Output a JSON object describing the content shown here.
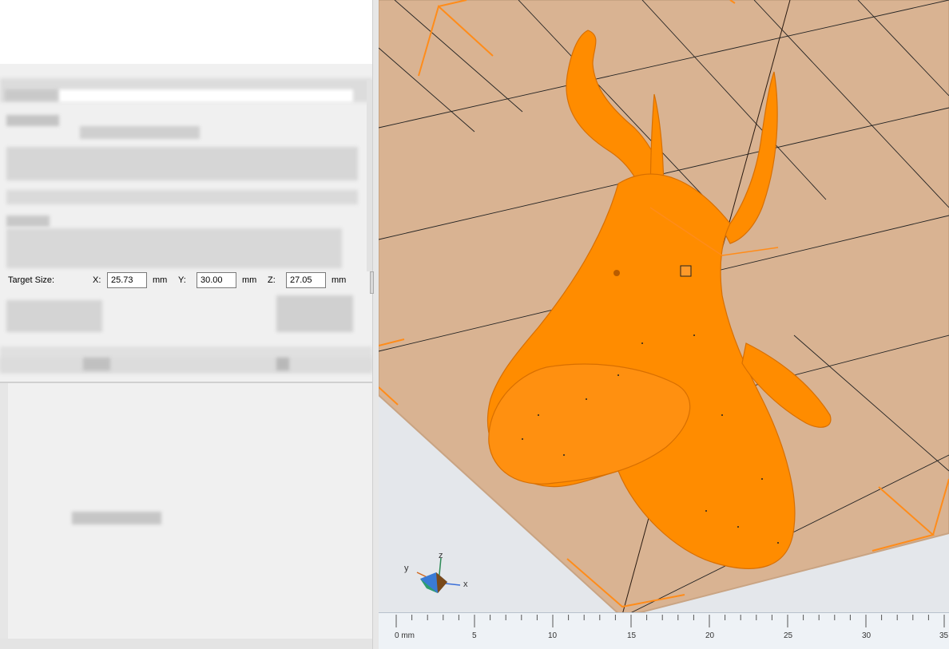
{
  "target_size": {
    "label": "Target Size:",
    "x_label": "X:",
    "x_value": "25.73",
    "y_label": "Y:",
    "y_value": "30.00",
    "z_label": "Z:",
    "z_value": "27.05",
    "unit": "mm"
  },
  "viewport": {
    "axes": {
      "x": "x",
      "y": "y",
      "z": "z"
    },
    "ruler": {
      "labels": [
        "0 mm",
        "5",
        "10",
        "15",
        "20",
        "25",
        "30",
        "35"
      ]
    },
    "model_color": "#ff8c00",
    "bed_color": "#d9b392"
  }
}
